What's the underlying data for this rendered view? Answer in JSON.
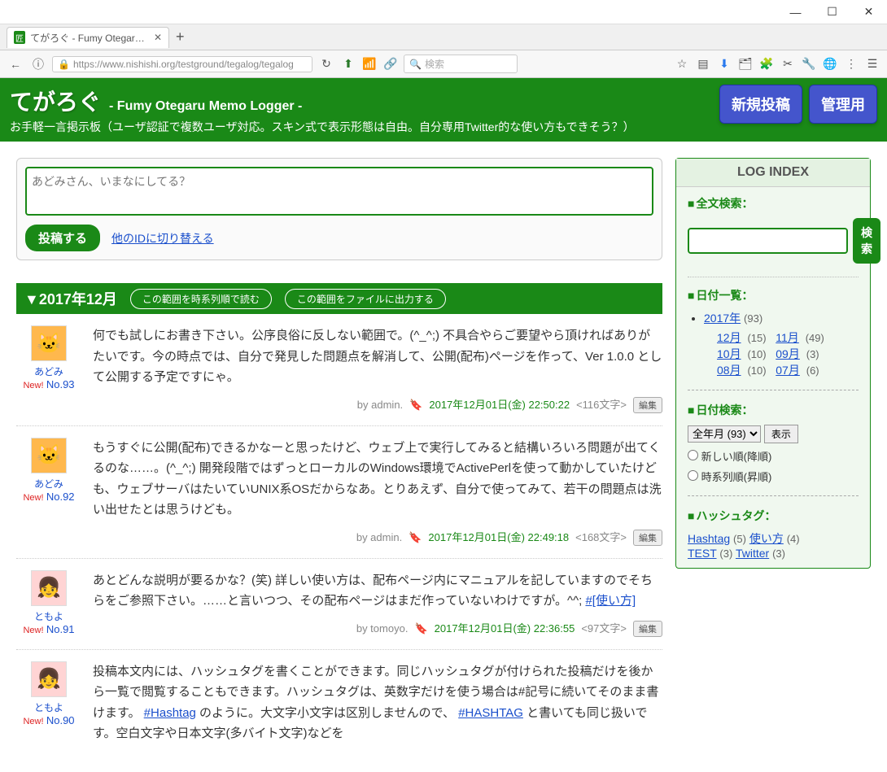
{
  "window": {
    "tab_title": "てがろぐ - Fumy Otegaru Mem",
    "url": "https://www.nishishi.org/testground/tegalog/tegalog",
    "search_placeholder": "検索"
  },
  "header": {
    "title": "てがろぐ",
    "subtitle": "- Fumy Otegaru Memo Logger -",
    "desc": "お手軽一言掲示板（ユーザ認証で複数ユーザ対応。スキン式で表示形態は自由。自分専用Twitter的な使い方もできそう？）",
    "new_post": "新規投稿",
    "admin": "管理用"
  },
  "compose": {
    "placeholder": "あどみさん、いまなにしてる？",
    "post_btn": "投稿する",
    "switch_link": "他のIDに切り替える"
  },
  "range": {
    "title": "▼2017年12月",
    "chrono": "この範囲を時系列順で読む",
    "export": "この範囲をファイルに出力する"
  },
  "posts": [
    {
      "avatar_type": "cat",
      "avatar_face": "🐱",
      "user": "あどみ",
      "new": "New!",
      "num": "No.93",
      "body": "何でも試しにお書き下さい。公序良俗に反しない範囲で。(^_^;) 不具合やらご要望やら頂ければありがたいです。今の時点では、自分で発見した問題点を解消して、公開(配布)ページを作って、Ver 1.0.0 として公開する予定ですにゃ。",
      "by": "by admin.",
      "date": "2017年12月01日(金) 22:50:22",
      "chars": "<116文字>",
      "edit": "編集"
    },
    {
      "avatar_type": "cat",
      "avatar_face": "🐱",
      "user": "あどみ",
      "new": "New!",
      "num": "No.92",
      "body": "もうすぐに公開(配布)できるかなーと思ったけど、ウェブ上で実行してみると結構いろいろ問題が出てくるのな……。(^_^;) 開発段階ではずっとローカルのWindows環境でActivePerlを使って動かしていたけども、ウェブサーバはたいていUNIX系OSだからなあ。とりあえず、自分で使ってみて、若干の問題点は洗い出せたとは思うけども。",
      "by": "by admin.",
      "date": "2017年12月01日(金) 22:49:18",
      "chars": "<168文字>",
      "edit": "編集"
    },
    {
      "avatar_type": "girl",
      "avatar_face": "👧",
      "user": "ともよ",
      "new": "New!",
      "num": "No.91",
      "body_pre": "あとどんな説明が要るかな？(笑) 詳しい使い方は、配布ページ内にマニュアルを記していますのでそちらをご参照下さい。……と言いつつ、その配布ページはまだ作っていないわけですが。^^;  ",
      "hash1": "#[使い方]",
      "by": "by tomoyo.",
      "date": "2017年12月01日(金) 22:36:55",
      "chars": "<97文字>",
      "edit": "編集"
    },
    {
      "avatar_type": "girl",
      "avatar_face": "👧",
      "user": "ともよ",
      "new": "New!",
      "num": "No.90",
      "body_pre": "投稿本文内には、ハッシュタグを書くことができます。同じハッシュタグが付けられた投稿だけを後から一覧で閲覧することもできます。ハッシュタグは、英数字だけを使う場合は#記号に続いてそのまま書けます。 ",
      "hash1": "#Hashtag",
      "body_mid": " のように。大文字小文字は区別しませんので、 ",
      "hash2": "#HASHTAG",
      "body_post": " と書いても同じ扱いです。空白文字や日本文字(多バイト文字)などを",
      "by": "",
      "date": "",
      "chars": "",
      "edit": ""
    }
  ],
  "sidebar": {
    "index_title": "LOG INDEX",
    "fulltext_label": "全文検索：",
    "search_btn": "検索",
    "datelist_label": "日付一覧：",
    "year": "2017年",
    "year_cnt": "(93)",
    "months": [
      {
        "m": "12月",
        "c": "(15)"
      },
      {
        "m": "11月",
        "c": "(49)"
      },
      {
        "m": "10月",
        "c": "(10)"
      },
      {
        "m": "09月",
        "c": "(3)"
      },
      {
        "m": "08月",
        "c": "(10)"
      },
      {
        "m": "07月",
        "c": "(6)"
      }
    ],
    "datesearch_label": "日付検索：",
    "select_value": "全年月 (93)",
    "display_btn": "表示",
    "order_desc": "新しい順(降順)",
    "order_asc": "時系列順(昇順)",
    "hashtag_label": "ハッシュタグ：",
    "tags": [
      {
        "t": "Hashtag",
        "c": "(5)"
      },
      {
        "t": "使い方",
        "c": "(4)"
      },
      {
        "t": "TEST",
        "c": "(3)"
      },
      {
        "t": "Twitter",
        "c": "(3)"
      }
    ]
  }
}
